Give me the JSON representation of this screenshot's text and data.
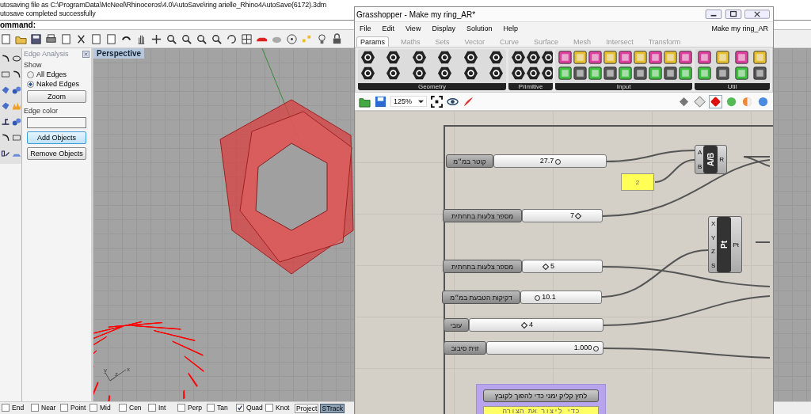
{
  "rhino": {
    "history": [
      "utosaving file as C:\\ProgramData\\McNeel\\Rhinoceros\\4.0\\AutoSave\\ring arielle_Rhino4AutoSave(6172).3dm",
      "utosave completed successfully"
    ],
    "command_prompt": "ommand:",
    "edge_analysis": {
      "title": "Edge Analysis",
      "show_label": "Show",
      "options": [
        {
          "label": "All Edges",
          "selected": false
        },
        {
          "label": "Naked Edges",
          "selected": true
        }
      ],
      "zoom_button": "Zoom",
      "color_label": "Edge color",
      "buttons": [
        {
          "label": "Add Objects",
          "focused": true
        },
        {
          "label": "Remove Objects",
          "focused": false
        }
      ]
    },
    "viewport": {
      "title": "Perspective",
      "axis_labels": [
        "y",
        "z",
        "x"
      ]
    },
    "osnaps": [
      {
        "label": "End",
        "checked": false,
        "kind": "checkbox"
      },
      {
        "label": "Near",
        "checked": false,
        "kind": "checkbox"
      },
      {
        "label": "Point",
        "checked": false,
        "kind": "checkbox"
      },
      {
        "label": "Mid",
        "checked": false,
        "kind": "checkbox"
      },
      {
        "label": "Cen",
        "checked": false,
        "kind": "checkbox"
      },
      {
        "label": "Int",
        "checked": false,
        "kind": "checkbox"
      },
      {
        "label": "Perp",
        "checked": false,
        "kind": "checkbox"
      },
      {
        "label": "Tan",
        "checked": false,
        "kind": "checkbox"
      },
      {
        "label": "Quad",
        "checked": true,
        "kind": "checkbox"
      },
      {
        "label": "Knot",
        "checked": false,
        "kind": "checkbox"
      },
      {
        "label": "Project",
        "checked": false,
        "kind": "toggle"
      },
      {
        "label": "STrack",
        "checked": true,
        "kind": "toggle"
      }
    ]
  },
  "grasshopper": {
    "title": "Grasshopper - Make my ring_AR*",
    "menu": [
      "File",
      "Edit",
      "View",
      "Display",
      "Solution",
      "Help"
    ],
    "document_name": "Make my ring_AR",
    "tabs": [
      {
        "label": "Params",
        "selected": true
      },
      {
        "label": "Maths",
        "selected": false
      },
      {
        "label": "Sets",
        "selected": false
      },
      {
        "label": "Vector",
        "selected": false
      },
      {
        "label": "Curve",
        "selected": false
      },
      {
        "label": "Surface",
        "selected": false
      },
      {
        "label": "Mesh",
        "selected": false
      },
      {
        "label": "Intersect",
        "selected": false
      },
      {
        "label": "Transform",
        "selected": false
      }
    ],
    "panels": [
      "Geometry",
      "Primitive",
      "Input",
      "Util"
    ],
    "zoom": "125%",
    "sliders": [
      {
        "label": "קוטר במ״מ",
        "value": "27.7",
        "level": 0.57,
        "kind": "float"
      },
      {
        "label": "מספר צלעות בתחתית",
        "value": "7",
        "level": 0.7,
        "kind": "integer"
      },
      {
        "label": "מספר צלעות בתחתית",
        "value": "5",
        "level": 0.29,
        "kind": "integer"
      },
      {
        "label": "דקיקות הטבעת במ״מ",
        "value": "10.1",
        "level": 0.2,
        "kind": "float"
      },
      {
        "label": "עובי",
        "value": "4",
        "level": 0.41,
        "kind": "integer"
      },
      {
        "label": "זוית סיבוב",
        "value": "1.000",
        "level": 0.94,
        "kind": "float"
      }
    ],
    "division": {
      "inputs": [
        "A",
        "B"
      ],
      "name": "A/B",
      "outputs": [
        "R"
      ]
    },
    "point": {
      "inputs": [
        "X",
        "Y",
        "Z",
        "S"
      ],
      "name": "Pt",
      "outputs": [
        "Pt"
      ]
    },
    "panel_value": "2",
    "group": {
      "button": "לחץ קליק ימני כדי להפוך לקובץ",
      "note": "כדי ליצור את הצורה"
    }
  }
}
